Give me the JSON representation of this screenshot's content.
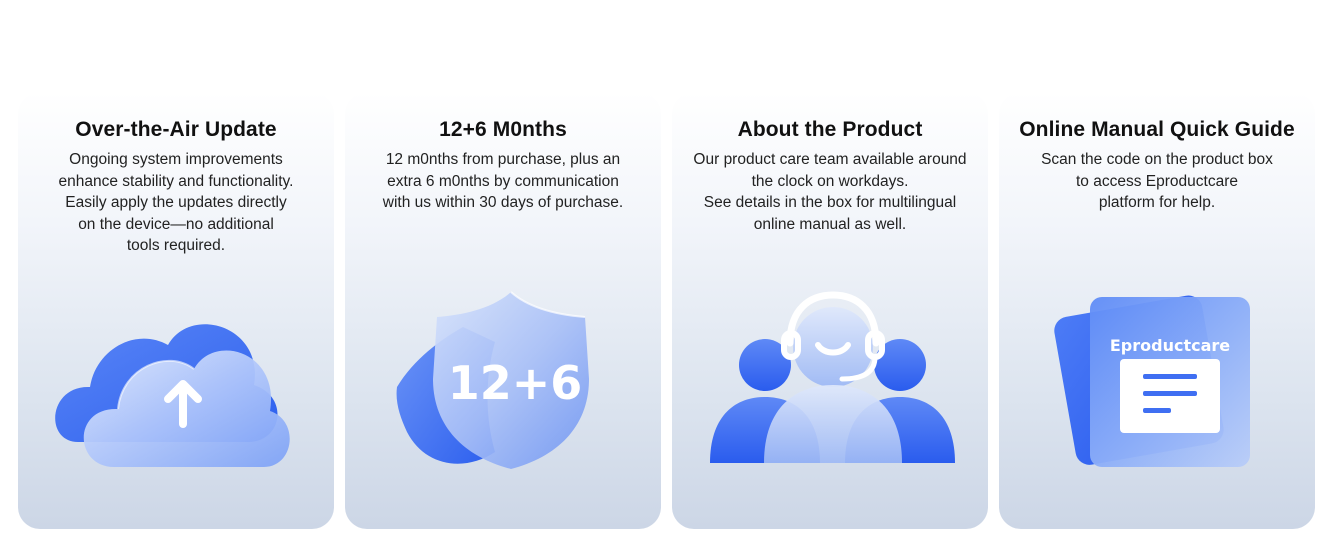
{
  "cards": [
    {
      "title": "Over-the-Air Update",
      "description": [
        "Ongoing system improvements",
        "enhance stability and functionality.",
        "Easily apply the updates directly",
        "on the device—no additional",
        "tools required."
      ],
      "icon": "cloud-upload-icon"
    },
    {
      "title": "12+6 M0nths",
      "description": [
        "12 m0nths from purchase, plus an",
        "extra 6 m0nths by communication",
        "with us within 30 days of purchase."
      ],
      "icon": "shield-warranty-icon",
      "badge": "12+6"
    },
    {
      "title": "About the Product",
      "description": [
        "Our product care team available around",
        "the clock on workdays.",
        "See details in the box for multilingual",
        "online manual as well."
      ],
      "icon": "support-agent-icon"
    },
    {
      "title": "Online Manual Quick Guide",
      "description": [
        "Scan the code on the product box",
        "to access Eproductcare",
        "platform for help."
      ],
      "icon": "manual-card-icon",
      "brand": "Eproductcare"
    }
  ],
  "colors": {
    "accent": "#2f63f0",
    "accent_light": "#6f9bfb",
    "card_bottom": "#ccd6e6"
  }
}
